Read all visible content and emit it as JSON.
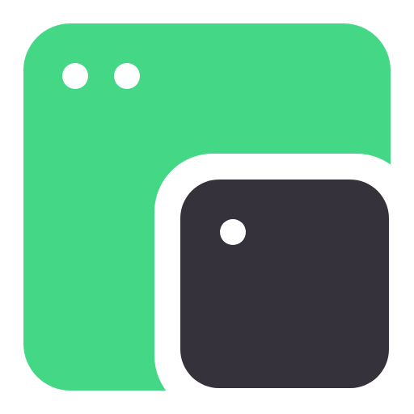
{
  "app_icon": {
    "icon_name": "windows-icon",
    "colors": {
      "background": "#ffffff",
      "back_window": "#44d886",
      "front_window": "#35323c",
      "dots": "#ffffff",
      "separator": "#ffffff"
    },
    "back_window": {
      "icon_name": "window-icon",
      "dot_count": 2
    },
    "front_window": {
      "icon_name": "window-icon",
      "dot_count": 1
    }
  }
}
